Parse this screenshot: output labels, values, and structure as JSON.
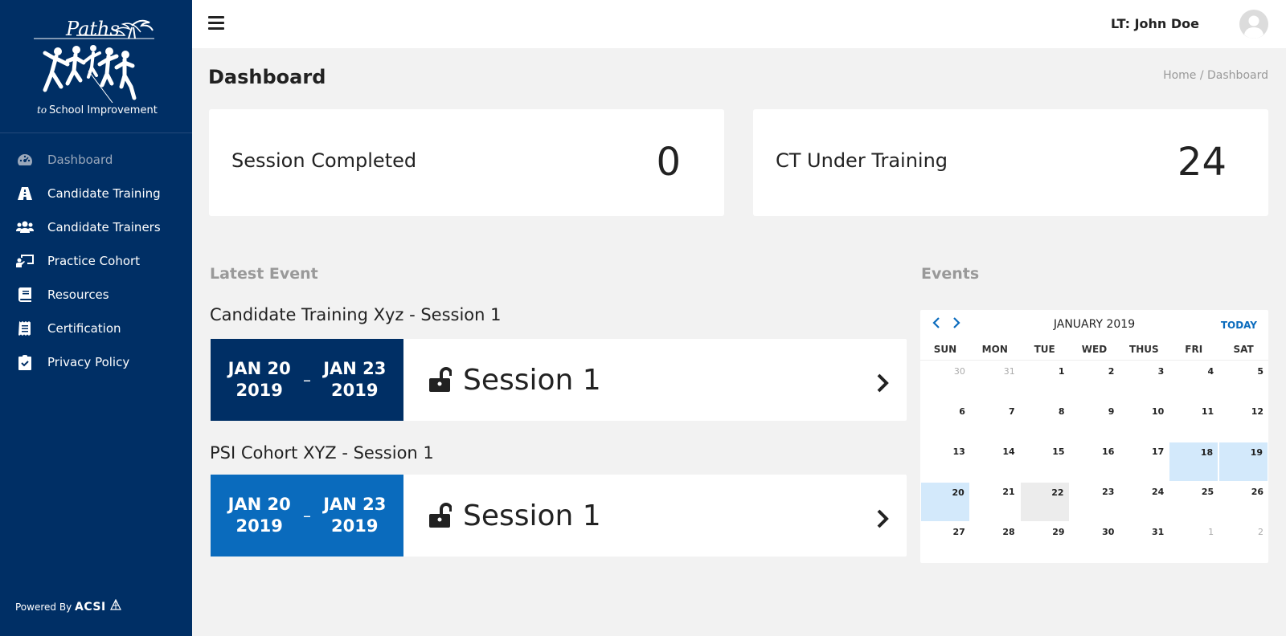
{
  "brand": {
    "logo_script": "Paths",
    "logo_for": "to",
    "logo_sub": "School Improvement",
    "powered_by": "Powered By",
    "powered_brand": "ACSI"
  },
  "sidebar": {
    "items": [
      {
        "label": "Dashboard",
        "icon": "dashboard-icon",
        "active": true
      },
      {
        "label": "Candidate Training",
        "icon": "road-icon"
      },
      {
        "label": "Candidate Trainers",
        "icon": "users-icon"
      },
      {
        "label": "Practice Cohort",
        "icon": "chalkboard-teacher-icon"
      },
      {
        "label": "Resources",
        "icon": "book-icon"
      },
      {
        "label": "Certification",
        "icon": "receipt-icon"
      },
      {
        "label": "Privacy Policy",
        "icon": "clipboard-check-icon"
      }
    ]
  },
  "topbar": {
    "user": "LT: John Doe"
  },
  "page": {
    "title": "Dashboard",
    "breadcrumb_home": "Home",
    "breadcrumb_sep": "/",
    "breadcrumb_current": "Dashboard"
  },
  "stats": [
    {
      "label": "Session Completed",
      "value": "0"
    },
    {
      "label": "CT Under Training",
      "value": "24"
    }
  ],
  "latest_event": {
    "heading": "Latest Event",
    "events": [
      {
        "title": "Candidate Training Xyz - Session 1",
        "start_md": "JAN 20",
        "start_y": "2019",
        "dash": "–",
        "end_md": "JAN 23",
        "end_y": "2019",
        "session": "Session 1",
        "color": "#002f65"
      },
      {
        "title": "PSI Cohort XYZ - Session 1",
        "start_md": "JAN 20",
        "start_y": "2019",
        "dash": "–",
        "end_md": "JAN 23",
        "end_y": "2019",
        "session": "Session 1",
        "color": "#0a6bbd"
      }
    ]
  },
  "events_panel": {
    "heading": "Events",
    "month": "JANUARY 2019",
    "today_label": "TODAY",
    "weekdays": [
      "SUN",
      "MON",
      "TUE",
      "WED",
      "THUS",
      "FRI",
      "SAT"
    ],
    "days": [
      {
        "d": "30",
        "other": true
      },
      {
        "d": "31",
        "other": true
      },
      {
        "d": "1"
      },
      {
        "d": "2"
      },
      {
        "d": "3"
      },
      {
        "d": "4"
      },
      {
        "d": "5"
      },
      {
        "d": "6"
      },
      {
        "d": "7"
      },
      {
        "d": "8"
      },
      {
        "d": "9"
      },
      {
        "d": "10"
      },
      {
        "d": "11"
      },
      {
        "d": "12"
      },
      {
        "d": "13"
      },
      {
        "d": "14"
      },
      {
        "d": "15"
      },
      {
        "d": "16"
      },
      {
        "d": "17"
      },
      {
        "d": "18",
        "event": true
      },
      {
        "d": "19",
        "event": true
      },
      {
        "d": "20",
        "event": true
      },
      {
        "d": "21"
      },
      {
        "d": "22",
        "today": true
      },
      {
        "d": "23"
      },
      {
        "d": "24"
      },
      {
        "d": "25"
      },
      {
        "d": "26"
      },
      {
        "d": "27"
      },
      {
        "d": "28"
      },
      {
        "d": "29"
      },
      {
        "d": "30"
      },
      {
        "d": "31"
      },
      {
        "d": "1",
        "other": true
      },
      {
        "d": "2",
        "other": true
      }
    ]
  }
}
